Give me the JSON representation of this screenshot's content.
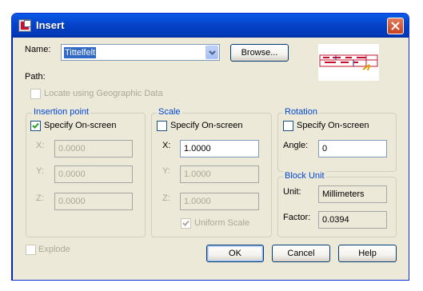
{
  "window": {
    "title": "Insert"
  },
  "name": {
    "label": "Name:",
    "value": "Tittelfelt",
    "browse_label": "Browse..."
  },
  "path": {
    "label": "Path:"
  },
  "geo": {
    "label": "Locate using Geographic Data",
    "checked": false,
    "enabled": false
  },
  "insertion_point": {
    "title": "Insertion point",
    "specify_label": "Specify On-screen",
    "specify_checked": true,
    "x_label": "X:",
    "x_value": "0.0000",
    "y_label": "Y:",
    "y_value": "0.0000",
    "z_label": "Z:",
    "z_value": "0.0000"
  },
  "scale": {
    "title": "Scale",
    "specify_label": "Specify On-screen",
    "specify_checked": false,
    "x_label": "X:",
    "x_value": "1.0000",
    "y_label": "Y:",
    "y_value": "1.0000",
    "z_label": "Z:",
    "z_value": "1.0000",
    "uniform_label": "Uniform Scale",
    "uniform_checked": true
  },
  "rotation": {
    "title": "Rotation",
    "specify_label": "Specify On-screen",
    "specify_checked": false,
    "angle_label": "Angle:",
    "angle_value": "0"
  },
  "block_unit": {
    "title": "Block Unit",
    "unit_label": "Unit:",
    "unit_value": "Millimeters",
    "factor_label": "Factor:",
    "factor_value": "0.0394"
  },
  "explode": {
    "label": "Explode",
    "checked": false,
    "enabled": false
  },
  "buttons": {
    "ok": "OK",
    "cancel": "Cancel",
    "help": "Help"
  },
  "colors": {
    "title_bar": "#0A5BE8",
    "dialog_bg": "#ECE9D8",
    "group_title": "#0046D5",
    "selection": "#316AC5",
    "close_button": "#C9421F"
  }
}
